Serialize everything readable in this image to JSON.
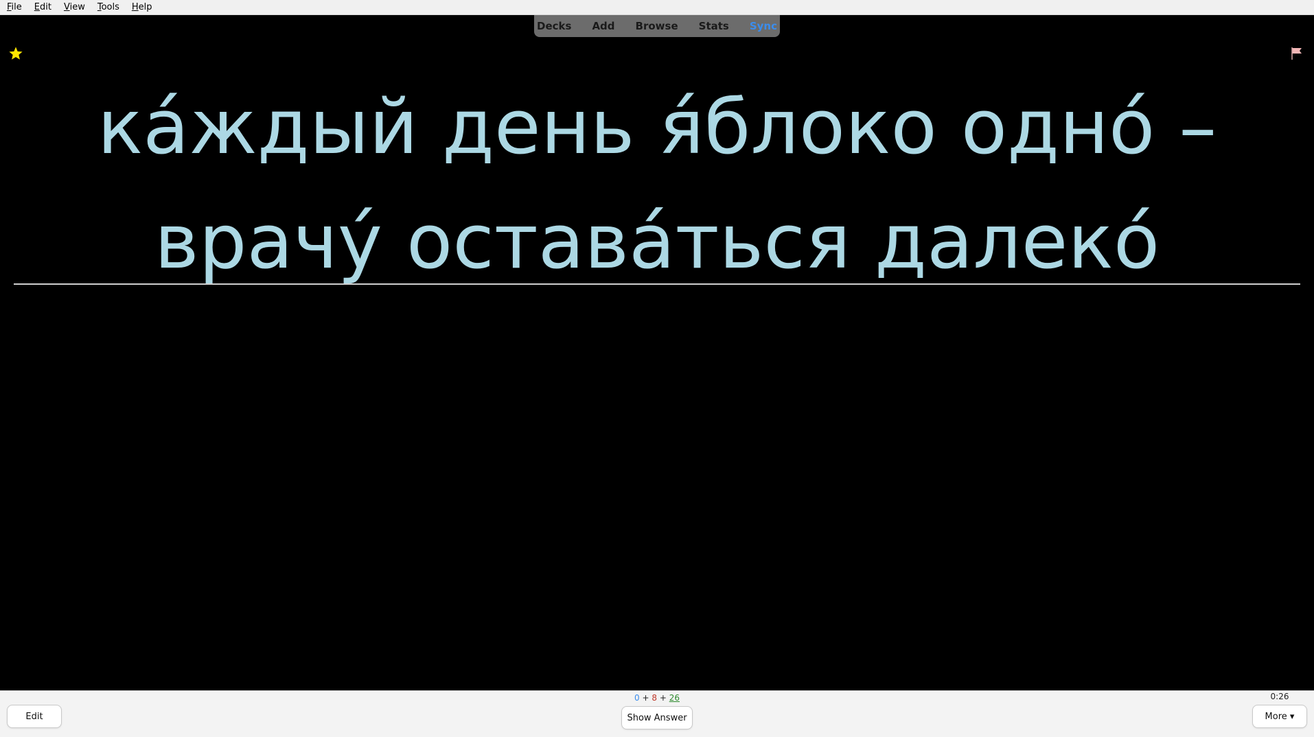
{
  "menubar": {
    "items": [
      {
        "label": "File",
        "mnemonic": "F",
        "rest": "ile"
      },
      {
        "label": "Edit",
        "mnemonic": "E",
        "rest": "dit"
      },
      {
        "label": "View",
        "mnemonic": "V",
        "rest": "iew"
      },
      {
        "label": "Tools",
        "mnemonic": "T",
        "rest": "ools"
      },
      {
        "label": "Help",
        "mnemonic": "H",
        "rest": "elp"
      }
    ]
  },
  "topnav": {
    "links": [
      "Decks",
      "Add",
      "Browse",
      "Stats",
      "Sync"
    ],
    "sync_color": "#3b8ded"
  },
  "card": {
    "front_text": "ка́ждый день я́блоко одно́ – врачу́ оставáться далеко́",
    "text_color": "#acd8e4",
    "background": "#000000",
    "marked_icon": "star-icon",
    "flag_icon": "flag-icon",
    "star_color": "#ffe600",
    "flag_color": "#f2b6b6"
  },
  "bottombar": {
    "edit_label": "Edit",
    "show_answer_label": "Show Answer",
    "more_label": "More ▾",
    "timer": "0:26",
    "counts": {
      "new": "0",
      "learn": "8",
      "review": "26",
      "sep": "+"
    }
  }
}
